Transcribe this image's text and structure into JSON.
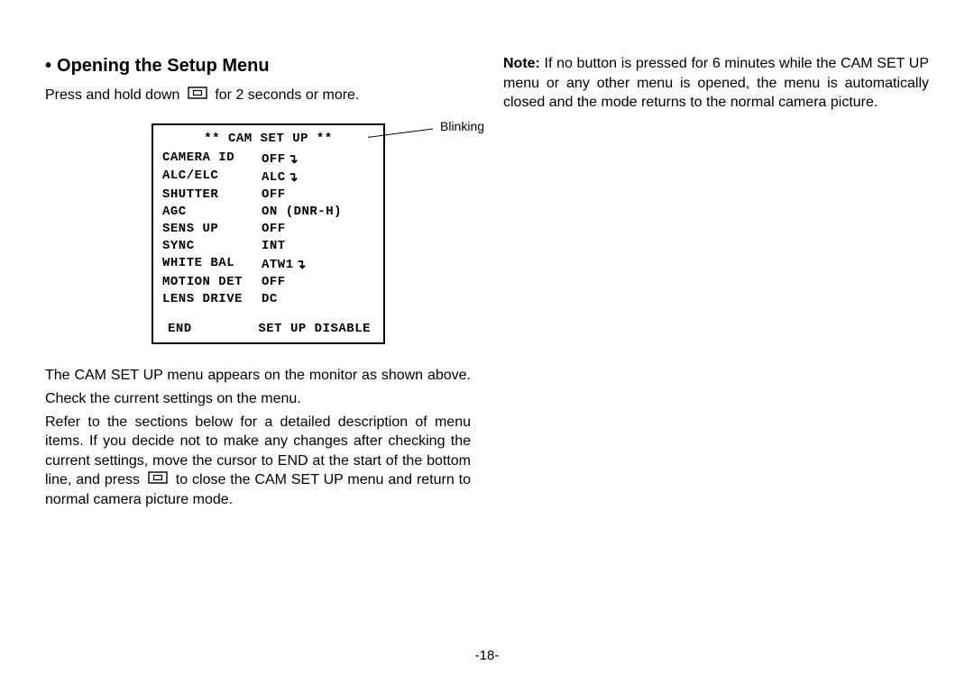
{
  "heading": {
    "bullet": "•",
    "text": "Opening the Setup Menu"
  },
  "intro": {
    "prefix": "Press and hold down ",
    "suffix": " for 2 seconds or more."
  },
  "callout_label": "Blinking",
  "menu": {
    "title": "** CAM SET UP **",
    "rows": [
      {
        "label": "CAMERA ID",
        "value": "OFF",
        "submenu": true
      },
      {
        "label": "ALC/ELC",
        "value": "ALC",
        "submenu": true
      },
      {
        "label": "SHUTTER",
        "value": "OFF",
        "submenu": false
      },
      {
        "label": "AGC",
        "value": "ON (DNR-H)",
        "submenu": false
      },
      {
        "label": "SENS UP",
        "value": "OFF",
        "submenu": false
      },
      {
        "label": "SYNC",
        "value": "INT",
        "submenu": false
      },
      {
        "label": "WHITE BAL",
        "value": "ATW1",
        "submenu": true
      },
      {
        "label": "MOTION DET",
        "value": "OFF",
        "submenu": false
      },
      {
        "label": "LENS DRIVE",
        "value": "DC",
        "submenu": false
      }
    ],
    "bottom_left": "END",
    "bottom_right": "SET UP DISABLE"
  },
  "body": {
    "p1": "The CAM SET UP menu appears on the monitor as shown above.",
    "p2": "Check the current settings on the menu.",
    "p3a": "Refer to the sections below for a detailed description of menu items. If you decide not to make any changes after checking the current settings, move the cursor to END at the start of the bottom line, and press ",
    "p3b": " to close the CAM SET UP menu and return to normal camera picture mode."
  },
  "note": {
    "label": "Note:",
    "text": " If no button is pressed for 6 minutes while the CAM SET UP menu or any other menu is opened, the menu is automatically closed and the mode returns to the normal camera picture."
  },
  "page_number": "-18-",
  "submenu_glyph": "↴"
}
